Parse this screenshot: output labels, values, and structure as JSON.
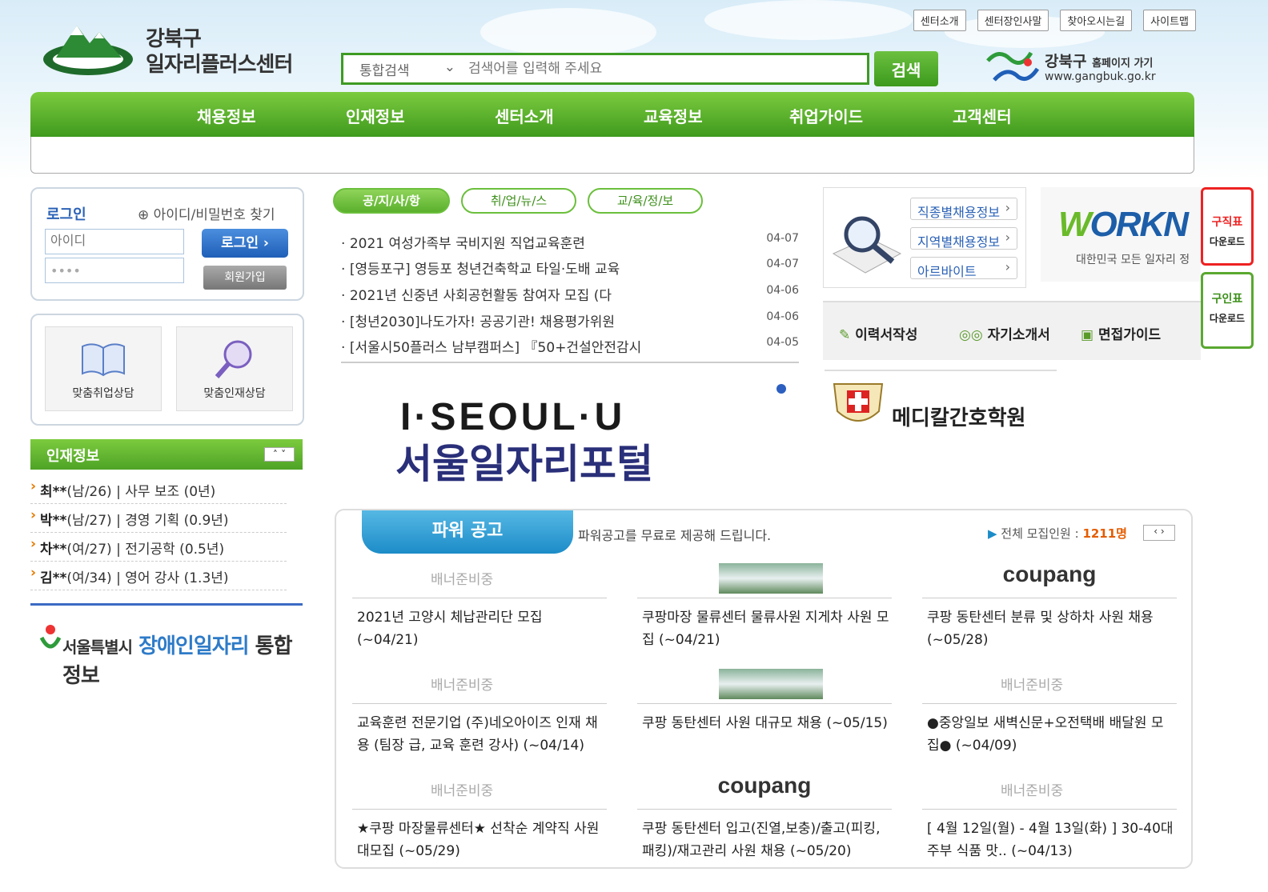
{
  "header": {
    "site_name_line1": "강북구",
    "site_name_line2": "일자리플러스센터",
    "top_links": [
      "센터소개",
      "센터장인사말",
      "찾아오시는길",
      "사이트맵"
    ],
    "search": {
      "category": "통합검색",
      "placeholder": "검색어를 입력해 주세요",
      "button": "검색"
    },
    "gangbuk": {
      "title": "강북구",
      "subtitle": "홈페이지 가기",
      "url": "www.gangbuk.go.kr"
    },
    "gnb": [
      "채용정보",
      "인재정보",
      "센터소개",
      "교육정보",
      "취업가이드",
      "고객센터"
    ]
  },
  "login": {
    "title": "로그인",
    "find": "아이디/비밀번호 찾기",
    "id_placeholder": "아이디",
    "pw_value": "••••",
    "login_button": "로그인 ›",
    "join_button": "회원가입"
  },
  "consult": [
    "맞춤취업상담",
    "맞춤인재상담"
  ],
  "talent": {
    "title": "인재정보",
    "rows": [
      {
        "name": "최**",
        "info": "(남/26) | 사무 보조 (0년)"
      },
      {
        "name": "박**",
        "info": "(남/27) | 경영 기획 (0.9년)"
      },
      {
        "name": "차**",
        "info": "(여/27) | 전기공학 (0.5년)"
      },
      {
        "name": "김**",
        "info": "(여/34) | 영어 강사 (1.3년)"
      }
    ]
  },
  "disability_banner": {
    "prefix": "서울특별시",
    "highlight": "장애인일자리",
    "suffix": "통합정보"
  },
  "notice_tabs": [
    "공/지/사/항",
    "취/업/뉴/스",
    "교/육/정/보"
  ],
  "notices": [
    {
      "title": "2021 여성가족부 국비지원 직업교육훈련",
      "date": "04-07"
    },
    {
      "title": "[영등포구] 영등포 청년건축학교 타일·도배 교육",
      "date": "04-07"
    },
    {
      "title": "2021년 신중년 사회공헌활동 참여자 모집 (다",
      "date": "04-06"
    },
    {
      "title": "[청년2030]나도가자! 공공기관! 채용평가위원",
      "date": "04-06"
    },
    {
      "title": "[서울시50플러스 남부캠퍼스] 『50+건설안전감시",
      "date": "04-05"
    }
  ],
  "seoul_banner": {
    "line1": "I·SEOUL·U",
    "line2": "서울일자리포털"
  },
  "job_links": [
    "직종별채용정보",
    "지역별채용정보",
    "아르바이트"
  ],
  "worknet": {
    "logo_w": "W",
    "logo_rest": "ORKN",
    "subtitle": "대한민국 모든 일자리 정"
  },
  "side_buttons": [
    {
      "title": "구직표",
      "sub": "다운로드"
    },
    {
      "title": "구인표",
      "sub": "다운로드"
    }
  ],
  "quick_links": [
    "이력서작성",
    "자기소개서",
    "면접가이드"
  ],
  "medical_banner": "메디칼간호학원",
  "power": {
    "tab": "파워 공고",
    "desc": "파워공고를 무료로 제공해 드립니다.",
    "count_label": "전체 모집인원 :",
    "count_value": "1211명",
    "nav": "‹ ›",
    "banner_ready": "배너준비중",
    "coupang_c": "coupang",
    "items": [
      {
        "banner": "ready",
        "title": "2021년 고양시 체납관리단 모집 (~04/21)"
      },
      {
        "banner": "image",
        "title": "쿠팡마장 물류센터 물류사원 지게차 사원 모집 (~04/21)"
      },
      {
        "banner": "coupang",
        "title": "쿠팡 동탄센터 분류 및 상하차 사원 채용 (~05/28)"
      },
      {
        "banner": "ready",
        "title": "교육훈련 전문기업 (주)네오아이즈 인재 채용 (팀장 급, 교육 훈련 강사) (~04/14)"
      },
      {
        "banner": "image",
        "title": "쿠팡 동탄센터 사원 대규모 채용 (~05/15)"
      },
      {
        "banner": "ready",
        "title": "●중앙일보 새벽신문+오전택배 배달원 모집● (~04/09)"
      },
      {
        "banner": "ready",
        "title": "★쿠팡 마장물류센터★ 선착순 계약직 사원 대모집 (~05/29)"
      },
      {
        "banner": "coupang",
        "title": "쿠팡 동탄센터 입고(진열,보충)/출고(피킹,패킹)/재고관리 사원 채용 (~05/20)"
      },
      {
        "banner": "ready",
        "title": "[ 4월 12일(월) - 4월 13일(화) ] 30-40대 주부 식품 맛.. (~04/13)"
      }
    ]
  }
}
